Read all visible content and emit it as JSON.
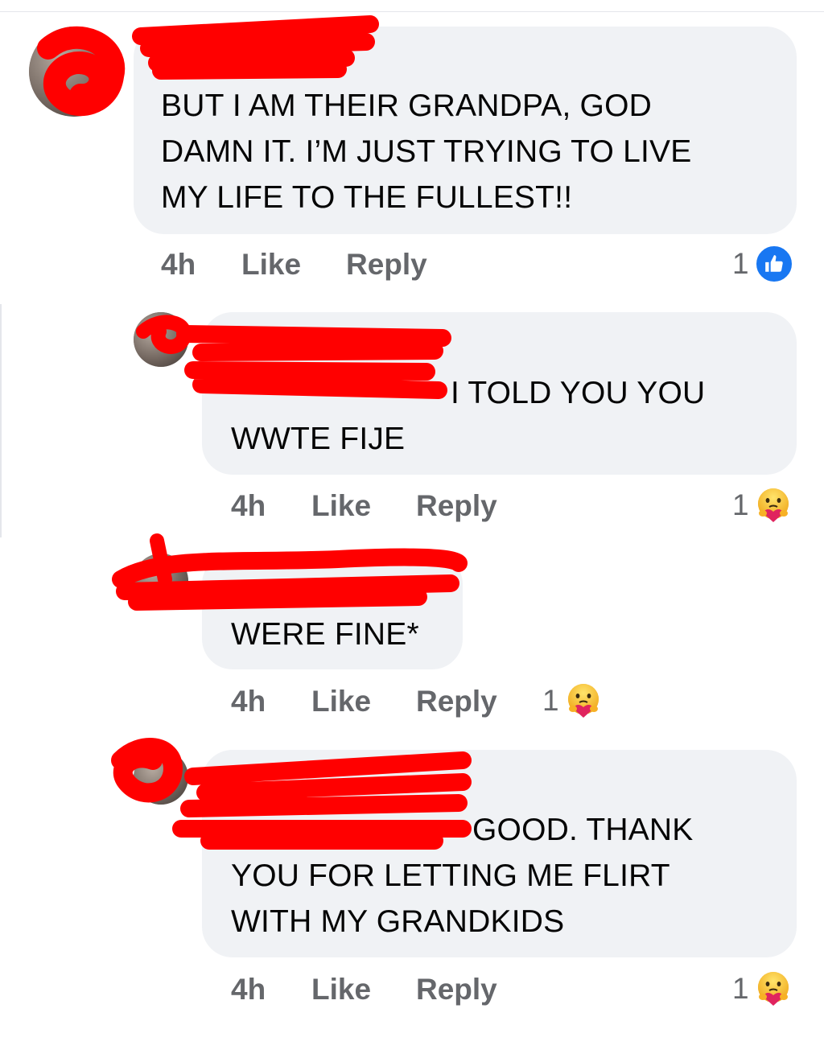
{
  "comments": [
    {
      "name": "",
      "text": "BUT I AM THEIR GRANDPA, GOD\nDAMN IT. I’M JUST TRYING TO LIVE\nMY LIFE TO THE FULLEST!!",
      "time": "4h",
      "like_label": "Like",
      "reply_label": "Reply",
      "reaction_count": "1",
      "reaction": "like-icon"
    },
    {
      "name": "",
      "text_line1": "I TOLD YOU YOU",
      "text_line2": "WWTE FIJE",
      "time": "4h",
      "like_label": "Like",
      "reply_label": "Reply",
      "reaction_count": "1",
      "reaction": "care-icon"
    },
    {
      "name": "",
      "text": "WERE FINE*",
      "time": "4h",
      "like_label": "Like",
      "reply_label": "Reply",
      "reaction_count": "1",
      "reaction": "care-icon"
    },
    {
      "name": "",
      "text_line1": "GOOD. THANK",
      "text_line2": "YOU FOR LETTING ME FLIRT",
      "text_line3": "WITH MY GRANDKIDS",
      "time": "4h",
      "like_label": "Like",
      "reply_label": "Reply",
      "reaction_count": "1",
      "reaction": "care-icon"
    }
  ],
  "colors": {
    "bubble": "#f0f2f5",
    "meta_text": "#65676b",
    "like_blue": "#1877f2",
    "redaction_red": "#ff0000"
  }
}
